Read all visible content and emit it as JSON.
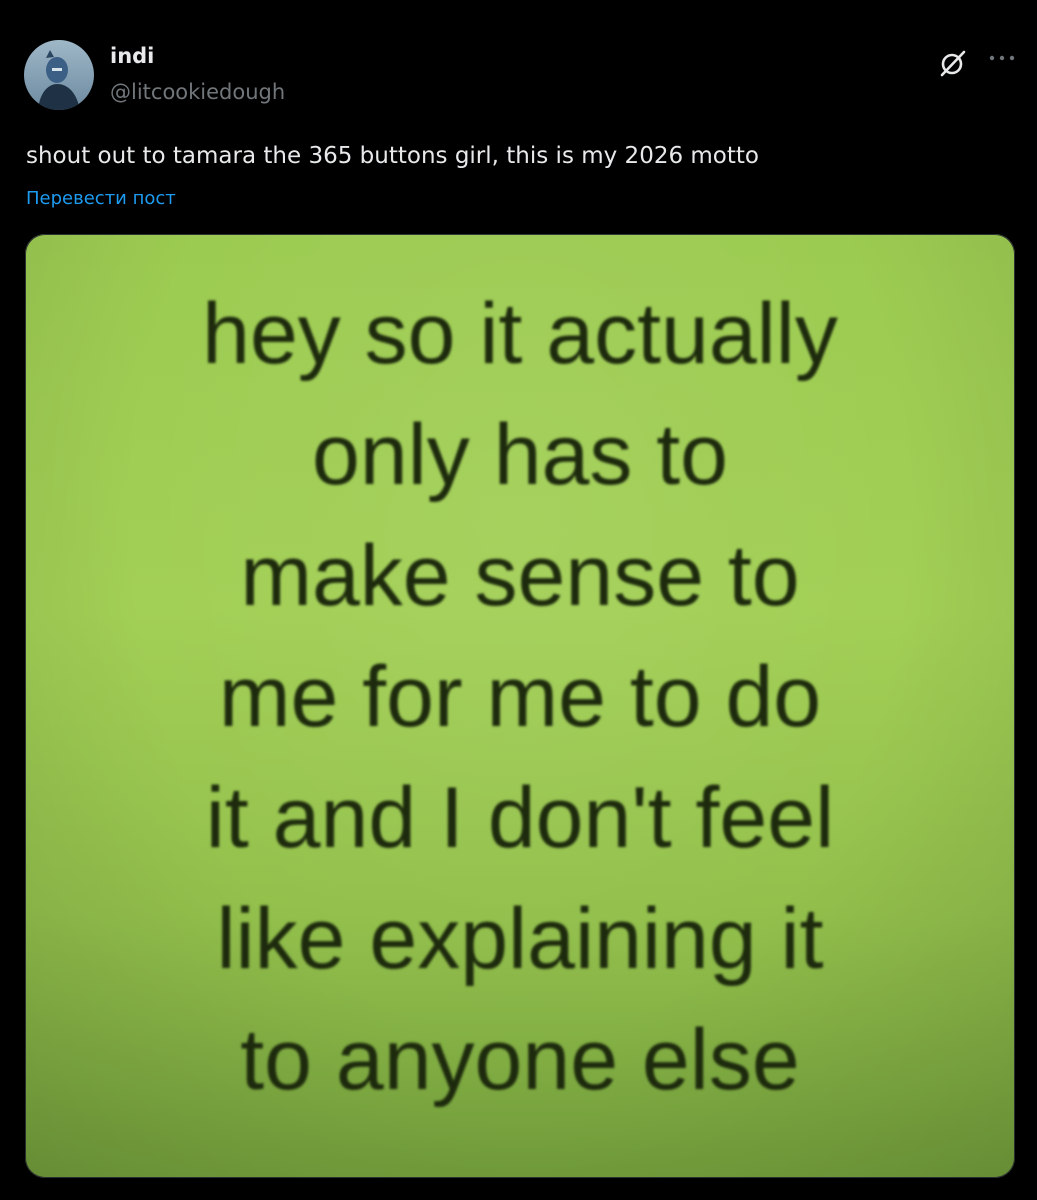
{
  "author": {
    "display_name": "indi",
    "handle": "@litcookiedough"
  },
  "post": {
    "text": "shout out to tamara the 365 buttons girl, this is my 2026 motto",
    "translate_label": "Перевести пост"
  },
  "media": {
    "lines": [
      "hey so it actually",
      "only has to",
      "make sense to",
      "me for me to do",
      "it and I don't feel",
      "like explaining it",
      "to anyone else"
    ],
    "background_color": "#9ccb51",
    "text_color": "#1d2a0d"
  },
  "icons": {
    "grok": "grok-icon",
    "more": "more-options-icon"
  },
  "colors": {
    "background": "#000000",
    "primary_text": "#e7e9ea",
    "secondary_text": "#71767b",
    "link": "#1d9bf0"
  }
}
